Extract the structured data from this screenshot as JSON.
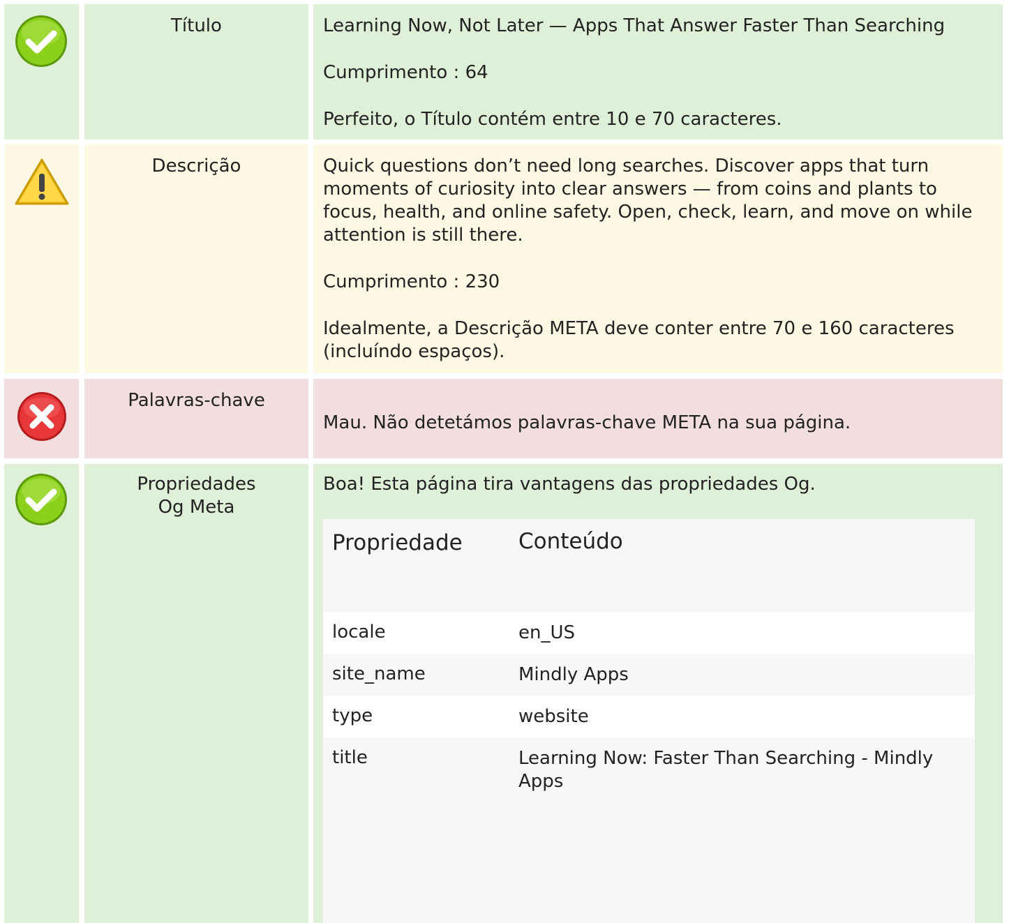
{
  "rows": {
    "title": {
      "status": "ok",
      "label": "Título",
      "value": "Learning Now, Not Later — Apps That Answer Faster Than Searching",
      "length": "Cumprimento : 64",
      "message": "Perfeito, o Título contém entre 10 e 70 caracteres."
    },
    "description": {
      "status": "warning",
      "label": "Descrição",
      "value": "Quick questions don’t need long searches. Discover apps that turn moments of curiosity into clear answers — from coins and plants to focus, health, and online safety. Open, check, learn, and move on while attention is still there.",
      "length": "Cumprimento : 230",
      "message": "Idealmente, a Descrição META deve conter entre 70 e 160 caracteres (incluíndo espaços)."
    },
    "keywords": {
      "status": "error",
      "label": "Palavras-chave",
      "message": "Mau. Não detetámos palavras-chave META na sua página."
    },
    "og": {
      "status": "ok",
      "label": "Propriedades Og Meta",
      "message": "Boa! Esta página tira vantagens das propriedades Og.",
      "table": {
        "headers": [
          "Propriedade",
          "Conteúdo"
        ],
        "rows": [
          {
            "property": "locale",
            "content": "en_US"
          },
          {
            "property": "site_name",
            "content": "Mindly Apps"
          },
          {
            "property": "type",
            "content": "website"
          },
          {
            "property": "title",
            "content": "Learning Now: Faster Than Searching - Mindly Apps"
          }
        ]
      }
    }
  },
  "colors": {
    "ok_bg": "#dff0d8",
    "warning_bg": "#fcf8e3",
    "error_bg": "#f2dede",
    "check_green": "#7ac70c",
    "warning_yellow": "#f5c518",
    "error_red": "#e53935"
  },
  "icons": {
    "ok": "check-circle-icon",
    "warning": "warning-triangle-icon",
    "error": "error-circle-icon"
  }
}
